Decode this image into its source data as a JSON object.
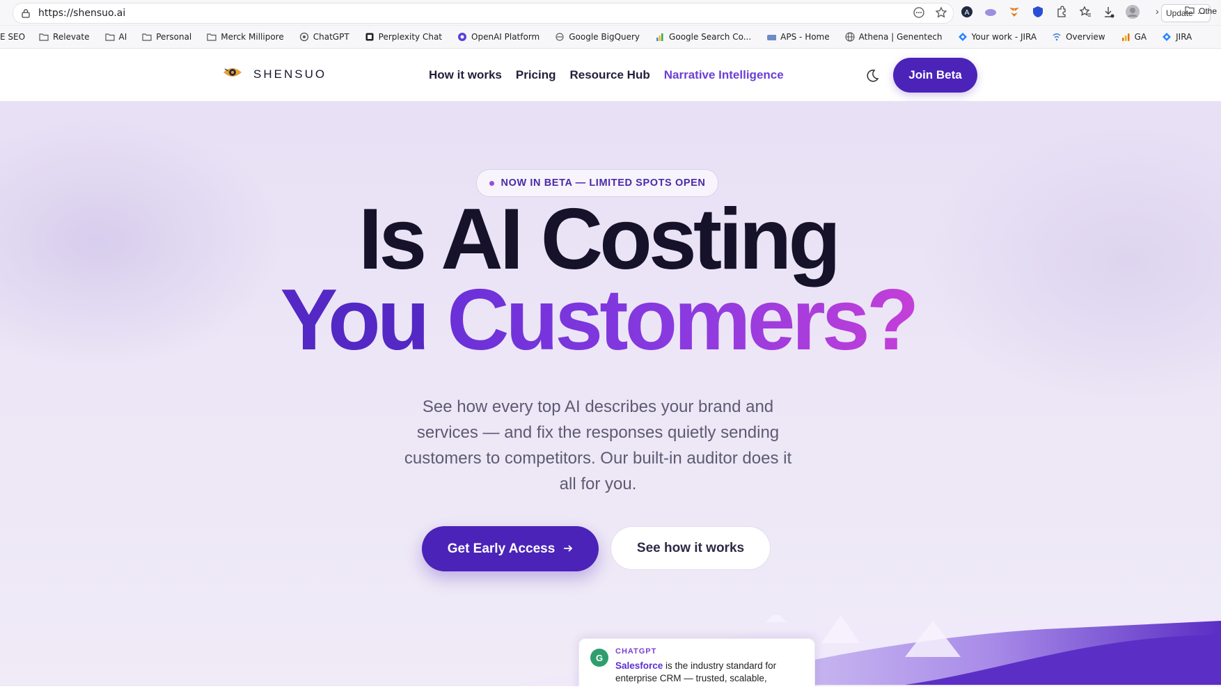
{
  "browser": {
    "url": "https://shensuo.ai",
    "update_label": "Update",
    "bookmarks": [
      {
        "label": "E SEO",
        "icon": "none"
      },
      {
        "label": "Relevate",
        "icon": "folder-icon"
      },
      {
        "label": "AI",
        "icon": "folder-icon"
      },
      {
        "label": "Personal",
        "icon": "folder-icon"
      },
      {
        "label": "Merck Millipore",
        "icon": "folder-icon"
      },
      {
        "label": "ChatGPT",
        "icon": "openai-icon"
      },
      {
        "label": "Perplexity Chat",
        "icon": "perplexity-icon"
      },
      {
        "label": "OpenAI Platform",
        "icon": "openai-platform-icon"
      },
      {
        "label": "Google BigQuery",
        "icon": "bigquery-icon"
      },
      {
        "label": "Google Search Co...",
        "icon": "search-console-icon"
      },
      {
        "label": "APS - Home",
        "icon": "aps-icon"
      },
      {
        "label": "Athena | Genentech",
        "icon": "globe-icon"
      },
      {
        "label": "Your work - JIRA",
        "icon": "jira-icon"
      },
      {
        "label": "Overview",
        "icon": "overview-icon"
      },
      {
        "label": "GA",
        "icon": "analytics-icon"
      },
      {
        "label": "JIRA",
        "icon": "jira-icon"
      }
    ],
    "other_bookmarks": "Othe"
  },
  "nav": {
    "logo_text": "SHENSUO",
    "links": [
      "How it works",
      "Pricing",
      "Resource Hub",
      "Narrative Intelligence"
    ],
    "join_label": "Join Beta"
  },
  "hero": {
    "badge": "NOW IN BETA — LIMITED SPOTS OPEN",
    "headline_line1": "Is AI Costing",
    "headline_you": "You",
    "headline_customers": "Customers?",
    "subcopy": "See how every top AI describes your brand and services — and fix the responses quietly sending customers to competitors. Our built-in auditor does it all for you.",
    "cta_primary": "Get Early Access",
    "cta_secondary": "See how it works"
  },
  "chat_card": {
    "avatar_letter": "G",
    "source": "CHATGPT",
    "brand": "Salesforce",
    "text": " is the industry standard for enterprise CRM — trusted, scalable,"
  },
  "colors": {
    "accent": "#4b23b8",
    "accent_link": "#6b3fd6",
    "headline_dark": "#16122a"
  }
}
